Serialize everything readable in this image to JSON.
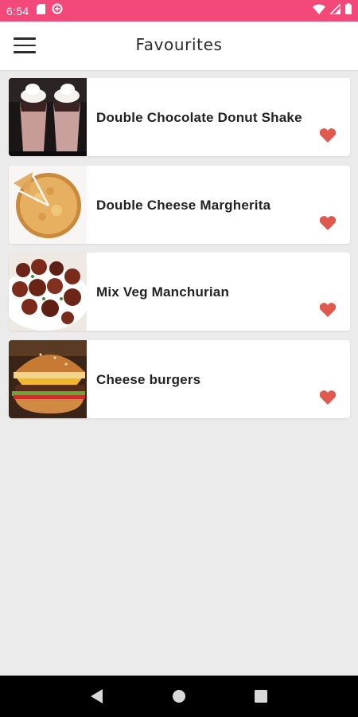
{
  "status_bar": {
    "time": "6:54",
    "left_icons": [
      "sd-card-icon",
      "data-saver-icon"
    ],
    "right_icons": [
      "wifi-icon",
      "signal-icon",
      "battery-icon"
    ],
    "background": "#f2487a"
  },
  "app_bar": {
    "title": "Favourites",
    "menu_icon": "hamburger-menu-icon"
  },
  "favourites": [
    {
      "name": "Double Chocolate Donut Shake",
      "image": "milkshake-image",
      "favourite": true
    },
    {
      "name": "Double Cheese Margherita",
      "image": "pizza-image",
      "favourite": true
    },
    {
      "name": "Mix Veg Manchurian",
      "image": "manchurian-image",
      "favourite": true
    },
    {
      "name": "Cheese burgers",
      "image": "burger-image",
      "favourite": true
    }
  ],
  "colors": {
    "heart": "#e0594f",
    "background": "#ebebeb",
    "card": "#ffffff"
  },
  "nav_bar": {
    "buttons": [
      "back-icon",
      "home-icon",
      "recents-icon"
    ]
  }
}
